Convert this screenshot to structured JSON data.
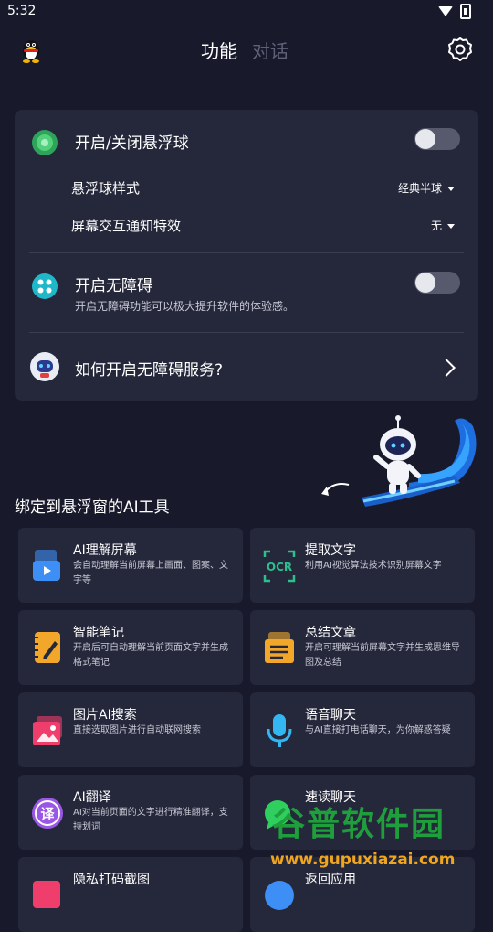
{
  "status": {
    "time": "5:32"
  },
  "header": {
    "tabs": [
      "功能",
      "对话"
    ]
  },
  "float_ball": {
    "toggle_label": "开启/关闭悬浮球",
    "toggle_on": false,
    "style_label": "悬浮球样式",
    "style_value": "经典半球",
    "effect_label": "屏幕交互通知特效",
    "effect_value": "无"
  },
  "accessibility": {
    "toggle_label": "开启无障碍",
    "toggle_on": false,
    "description": "开启无障碍功能可以极大提升软件的体验感。",
    "howto_label": "如何开启无障碍服务?"
  },
  "tools_section": {
    "title": "绑定到悬浮窗的AI工具"
  },
  "tools": [
    {
      "title": "AI理解屏幕",
      "desc": "会自动理解当前屏幕上画面、图案、文字等",
      "icon": "screen-understand-icon",
      "color": "#3d8ef5"
    },
    {
      "title": "提取文字",
      "desc": "利用AI视觉算法技术识别屏幕文字",
      "icon": "ocr-icon",
      "color": "#2dbf8c"
    },
    {
      "title": "智能笔记",
      "desc": "开启后可自动理解当前页面文字并生成格式笔记",
      "icon": "notebook-icon",
      "color": "#f2a72a"
    },
    {
      "title": "总结文章",
      "desc": "开启可理解当前屏幕文字并生成思维导图及总结",
      "icon": "summary-icon",
      "color": "#f2a72a"
    },
    {
      "title": "图片AI搜索",
      "desc": "直接选取图片进行自动联网搜索",
      "icon": "image-search-icon",
      "color": "#ef3e6c"
    },
    {
      "title": "语音聊天",
      "desc": "与AI直接打电话聊天，为你解惑答疑",
      "icon": "microphone-icon",
      "color": "#33b6f2"
    },
    {
      "title": "AI翻译",
      "desc": "AI对当前页面的文字进行精准翻译，支持划词",
      "icon": "translate-icon",
      "color": "#9a57e6"
    },
    {
      "title": "速读聊天",
      "desc": "",
      "icon": "chat-icon",
      "color": "#2fcf5f"
    },
    {
      "title": "隐私打码截图",
      "desc": "",
      "icon": "privacy-screenshot-icon",
      "color": "#ef3e6c"
    },
    {
      "title": "返回应用",
      "desc": "",
      "icon": "return-icon",
      "color": "#3d8ef5"
    }
  ],
  "watermark": {
    "line1": "谷普软件园",
    "line2": "www.gupuxiazai.com"
  }
}
